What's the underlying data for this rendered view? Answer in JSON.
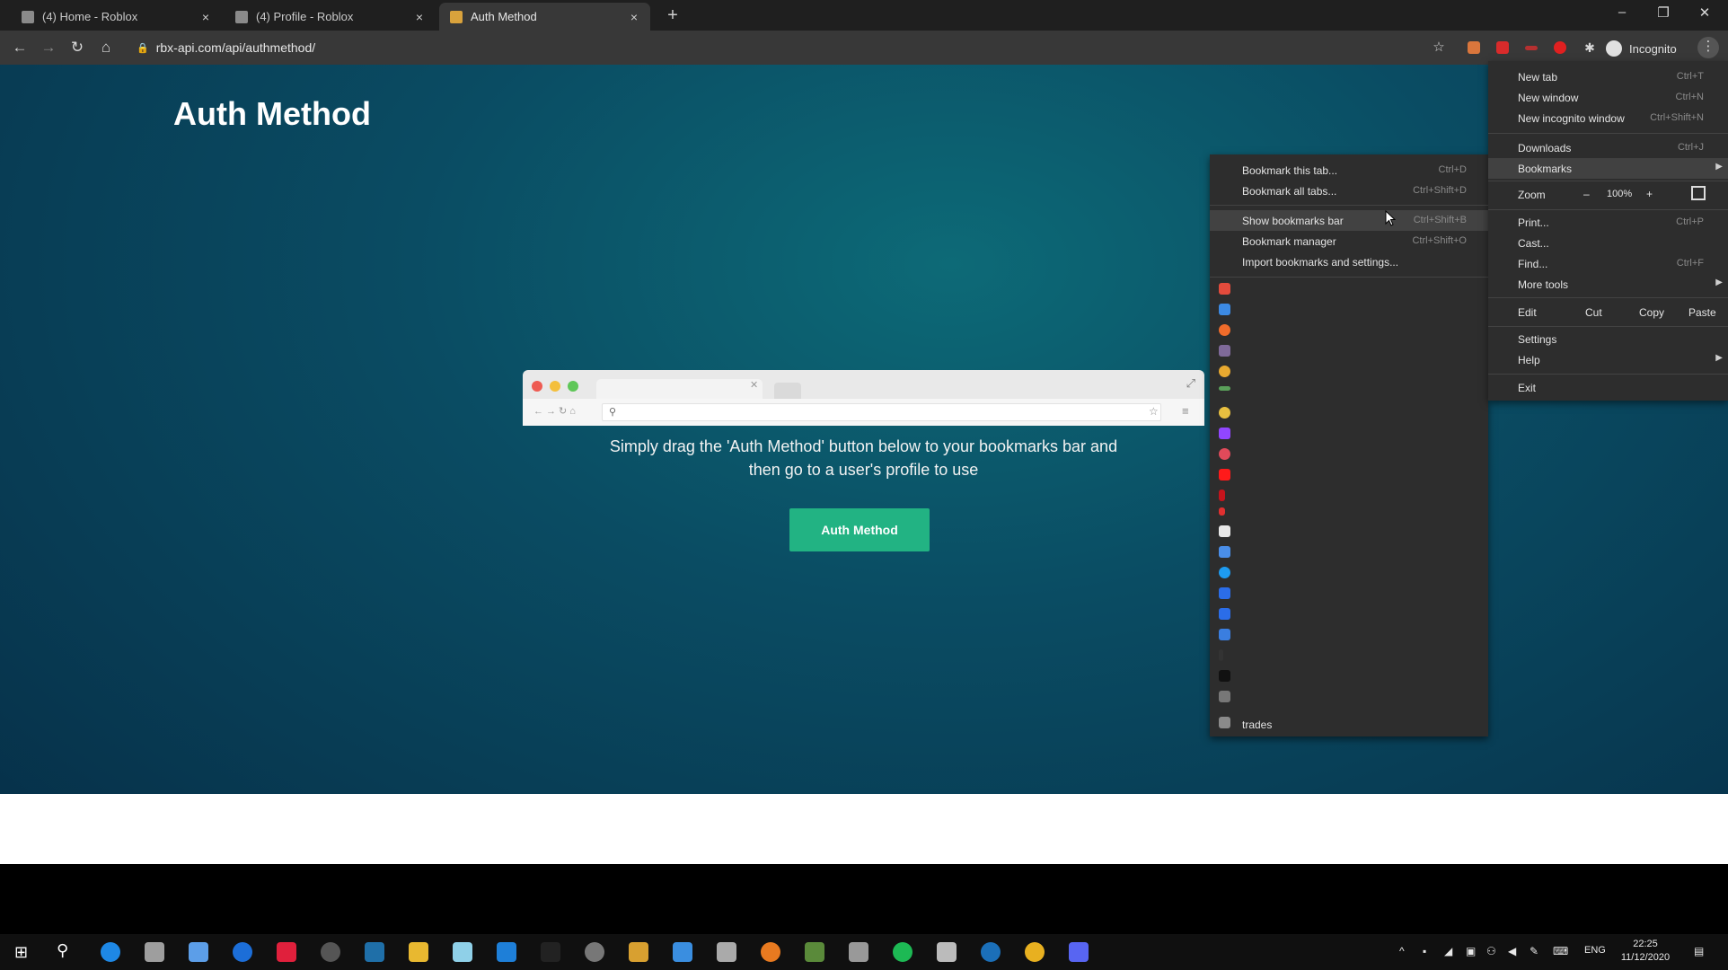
{
  "browser": {
    "tabs": [
      {
        "title": "(4) Home - Roblox",
        "active": false
      },
      {
        "title": "(4) Profile - Roblox",
        "active": false
      },
      {
        "title": "Auth Method",
        "active": true
      }
    ],
    "tab_close_glyph": "×",
    "new_tab_glyph": "+",
    "window_controls": [
      "–",
      "❐",
      "✕"
    ],
    "url": "rbx-api.com/api/authmethod/",
    "profile_label": "Incognito",
    "accent_colors": {
      "button": "#22b383",
      "page_bg": "#0a4c63"
    }
  },
  "page": {
    "heading": "Auth Method",
    "instruction_line1": "Simply drag the 'Auth Method' button below to your bookmarks bar and",
    "instruction_line2": "then go to a user's profile to use",
    "button_label": "Auth Method"
  },
  "main_menu": {
    "items": [
      {
        "label": "New tab",
        "shortcut": "Ctrl+T"
      },
      {
        "label": "New window",
        "shortcut": "Ctrl+N"
      },
      {
        "label": "New incognito window",
        "shortcut": "Ctrl+Shift+N"
      },
      {
        "label": "Downloads",
        "shortcut": "Ctrl+J"
      },
      {
        "label": "Bookmarks",
        "shortcut": ""
      },
      {
        "label": "Print...",
        "shortcut": "Ctrl+P"
      },
      {
        "label": "Cast...",
        "shortcut": ""
      },
      {
        "label": "Find...",
        "shortcut": "Ctrl+F"
      },
      {
        "label": "More tools",
        "shortcut": ""
      },
      {
        "label": "Settings",
        "shortcut": ""
      },
      {
        "label": "Help",
        "shortcut": ""
      },
      {
        "label": "Exit",
        "shortcut": ""
      }
    ],
    "zoom": {
      "label": "Zoom",
      "minus": "–",
      "value": "100%",
      "plus": "+"
    },
    "edit": {
      "label": "Edit",
      "cut": "Cut",
      "copy": "Copy",
      "paste": "Paste"
    }
  },
  "bookmarks_menu": {
    "items": [
      {
        "label": "Bookmark this tab...",
        "shortcut": "Ctrl+D"
      },
      {
        "label": "Bookmark all tabs...",
        "shortcut": "Ctrl+Shift+D"
      },
      {
        "label": "Show bookmarks bar",
        "shortcut": "Ctrl+Shift+B"
      },
      {
        "label": "Bookmark manager",
        "shortcut": "Ctrl+Shift+O"
      },
      {
        "label": "Import bookmarks and settings...",
        "shortcut": ""
      }
    ],
    "folder_label": "trades"
  },
  "taskbar": {
    "language": "ENG",
    "time": "22:25",
    "date": "11/12/2020"
  }
}
